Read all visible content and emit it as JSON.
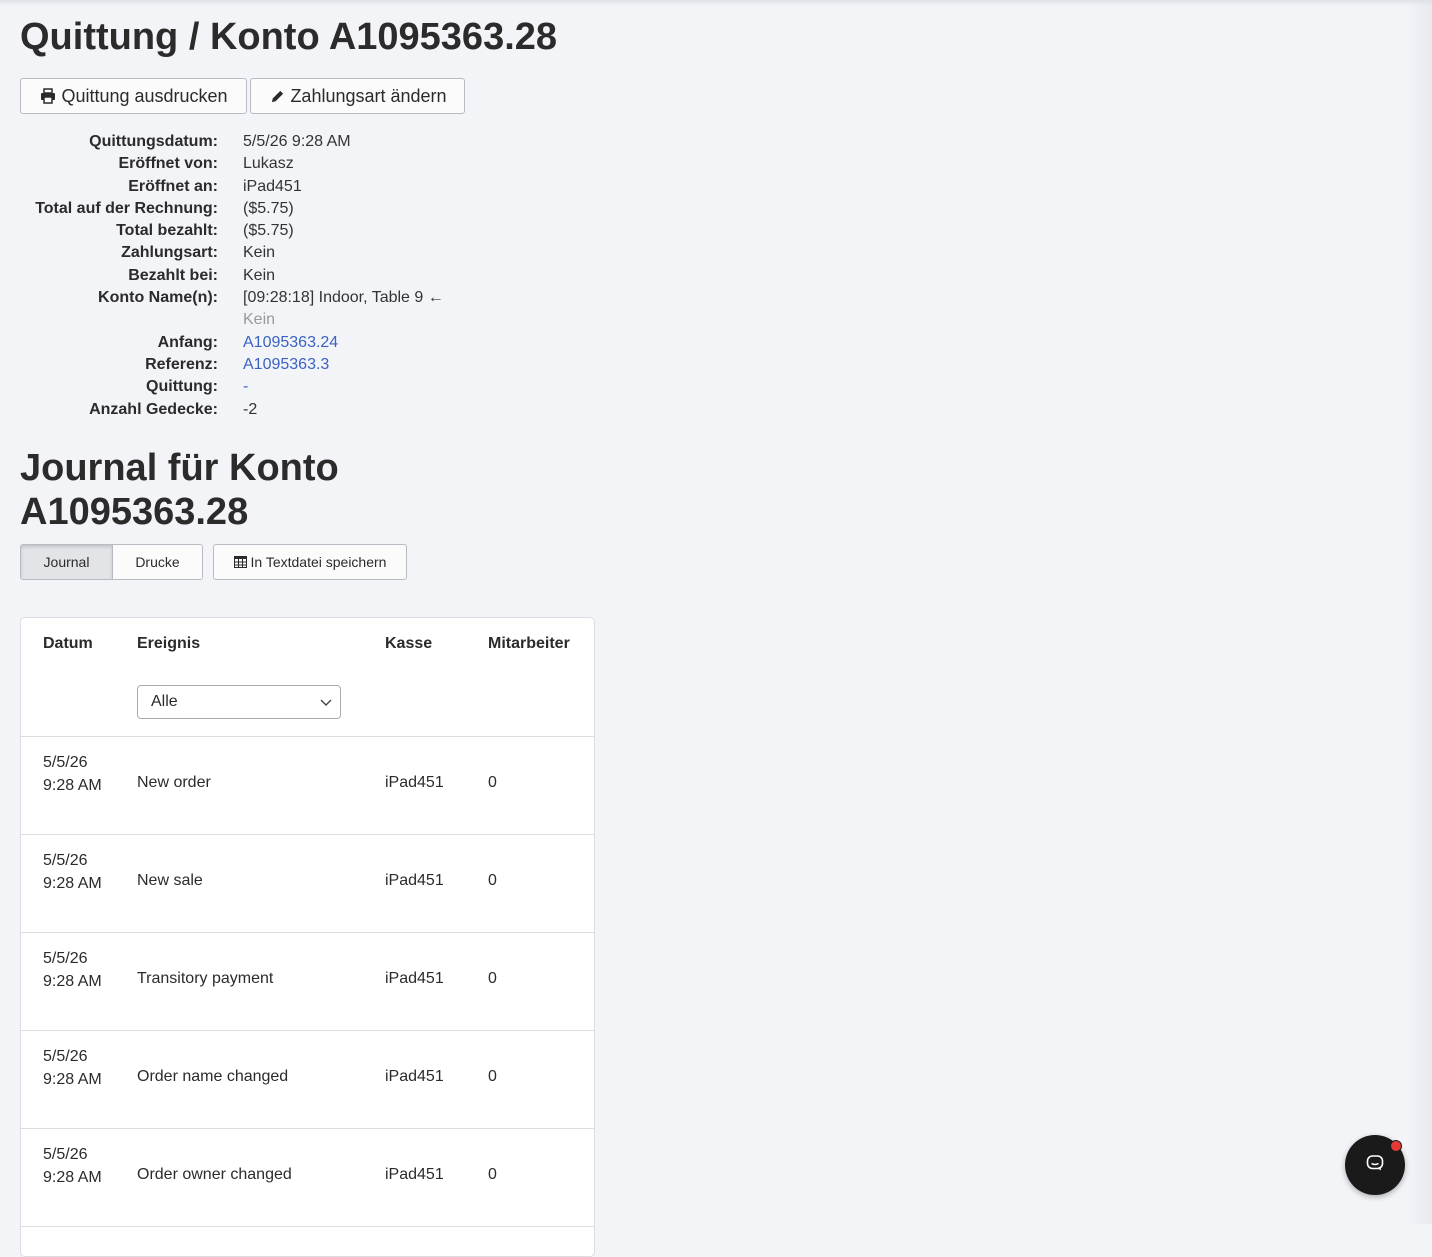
{
  "header": {
    "title": "Quittung / Konto A1095363.28",
    "print_label": "Quittung ausdrucken",
    "payment_label": "Zahlungsart ändern"
  },
  "details": [
    {
      "label": "Quittungsdatum:",
      "value": "5/5/26 9:28 AM"
    },
    {
      "label": "Eröffnet von:",
      "value": "Lukasz"
    },
    {
      "label": "Eröffnet an:",
      "value": "iPad451"
    },
    {
      "label": "Total auf der Rechnung:",
      "value": "($5.75)"
    },
    {
      "label": "Total bezahlt:",
      "value": "($5.75)"
    },
    {
      "label": "Zahlungsart:",
      "value": "Kein"
    },
    {
      "label": "Bezahlt bei:",
      "value": "Kein"
    },
    {
      "label": "Konto Name(n):",
      "value": "[09:28:18] Indoor, Table 9 ←",
      "value2": "Kein"
    },
    {
      "label": "Anfang:",
      "value": "A1095363.24"
    },
    {
      "label": "Referenz:",
      "value": "A1095363.3"
    },
    {
      "label": "Quittung:",
      "value": "-"
    },
    {
      "label": "Anzahl Gedecke:",
      "value": "-2"
    }
  ],
  "journal": {
    "title": "Journal für Konto A1095363.28",
    "tabs": [
      "Journal",
      "Drucke"
    ],
    "save_label": "In Textdatei speichern",
    "columns": [
      "Datum",
      "Ereignis",
      "Kasse",
      "Mitarbeiter"
    ],
    "filter_value": "Alle",
    "rows": [
      {
        "date": "5/5/26 9:28 AM",
        "event": "New order",
        "register": "iPad451",
        "employee": "0"
      },
      {
        "date": "5/5/26 9:28 AM",
        "event": "New sale",
        "register": "iPad451",
        "employee": "0"
      },
      {
        "date": "5/5/26 9:28 AM",
        "event": "Transitory payment",
        "register": "iPad451",
        "employee": "0"
      },
      {
        "date": "5/5/26 9:28 AM",
        "event": "Order name changed",
        "register": "iPad451",
        "employee": "0"
      },
      {
        "date": "5/5/26 9:28 AM",
        "event": "Order owner changed",
        "register": "iPad451",
        "employee": "0"
      }
    ]
  },
  "colors": {
    "link": "#3a62c4",
    "background": "#f3f4f8",
    "chat": "#1a1a1a",
    "badge": "#e53935"
  },
  "icons": {
    "print": "printer-icon",
    "edit": "pencil-icon",
    "table": "table-icon",
    "chat": "chat-icon"
  }
}
